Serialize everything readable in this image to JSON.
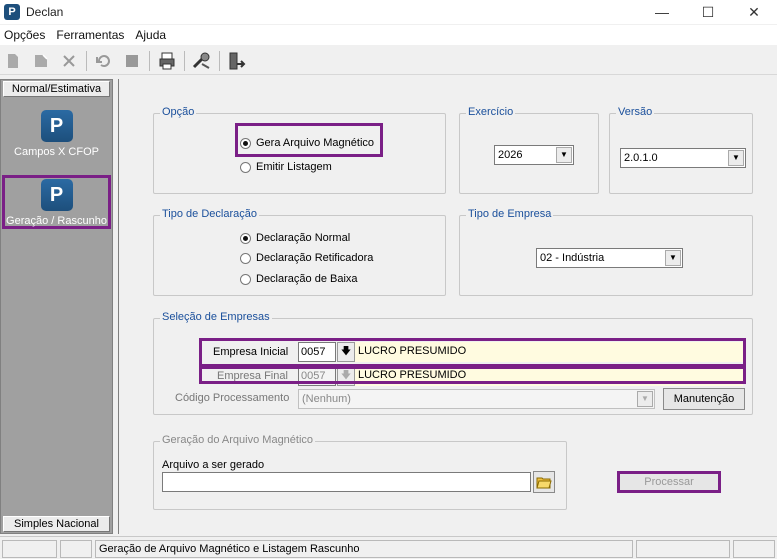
{
  "window": {
    "title": "Declan",
    "minimize": "—",
    "maximize": "☐",
    "close": "✕",
    "logo": "P"
  },
  "menu": [
    "Opções",
    "Ferramentas",
    "Ajuda"
  ],
  "toolbar": {
    "icons": [
      "new-icon",
      "open-icon",
      "delete-icon",
      "undo-icon",
      "stop-icon",
      "print-icon",
      "tools-icon",
      "exit-icon"
    ]
  },
  "sidebar": {
    "header": "Normal/Estimativa",
    "footer": "Simples Nacional",
    "items": [
      {
        "label": "Campos X CFOP",
        "icon": "P"
      },
      {
        "label": "Geração / Rascunho",
        "icon": "P"
      }
    ]
  },
  "opcao": {
    "title": "Opção",
    "options": [
      "Gera Arquivo Magnético",
      "Emitir Listagem"
    ],
    "selected": 0
  },
  "exercicio": {
    "title": "Exercício",
    "value": "2026"
  },
  "versao": {
    "title": "Versão",
    "value": "2.0.1.0"
  },
  "tipo_declaracao": {
    "title": "Tipo de Declaração",
    "options": [
      "Declaração Normal",
      "Declaração Retificadora",
      "Declaração de Baixa"
    ],
    "selected": 0
  },
  "tipo_empresa": {
    "title": "Tipo de Empresa",
    "value": "02 - Indústria"
  },
  "selecao": {
    "title": "Seleção de Empresas",
    "inicial_label": "Empresa Inicial",
    "inicial_code": "0057",
    "inicial_name": "LUCRO PRESUMIDO",
    "final_label": "Empresa Final",
    "final_code": "0057",
    "final_name": "LUCRO PRESUMIDO",
    "codigo_label": "Código Processamento",
    "codigo_value": "(Nenhum)",
    "manutencao": "Manutenção"
  },
  "geracao": {
    "title": "Geração do Arquivo Magnético",
    "arquivo_label": "Arquivo a ser gerado",
    "arquivo_value": ""
  },
  "processar": "Processar",
  "status": {
    "message": "Geração de Arquivo Magnético e Listagem Rascunho"
  },
  "colors": {
    "highlight": "#7a1f86",
    "sidebar": "#a0a0a0",
    "group_title": "#1a4f9b"
  }
}
